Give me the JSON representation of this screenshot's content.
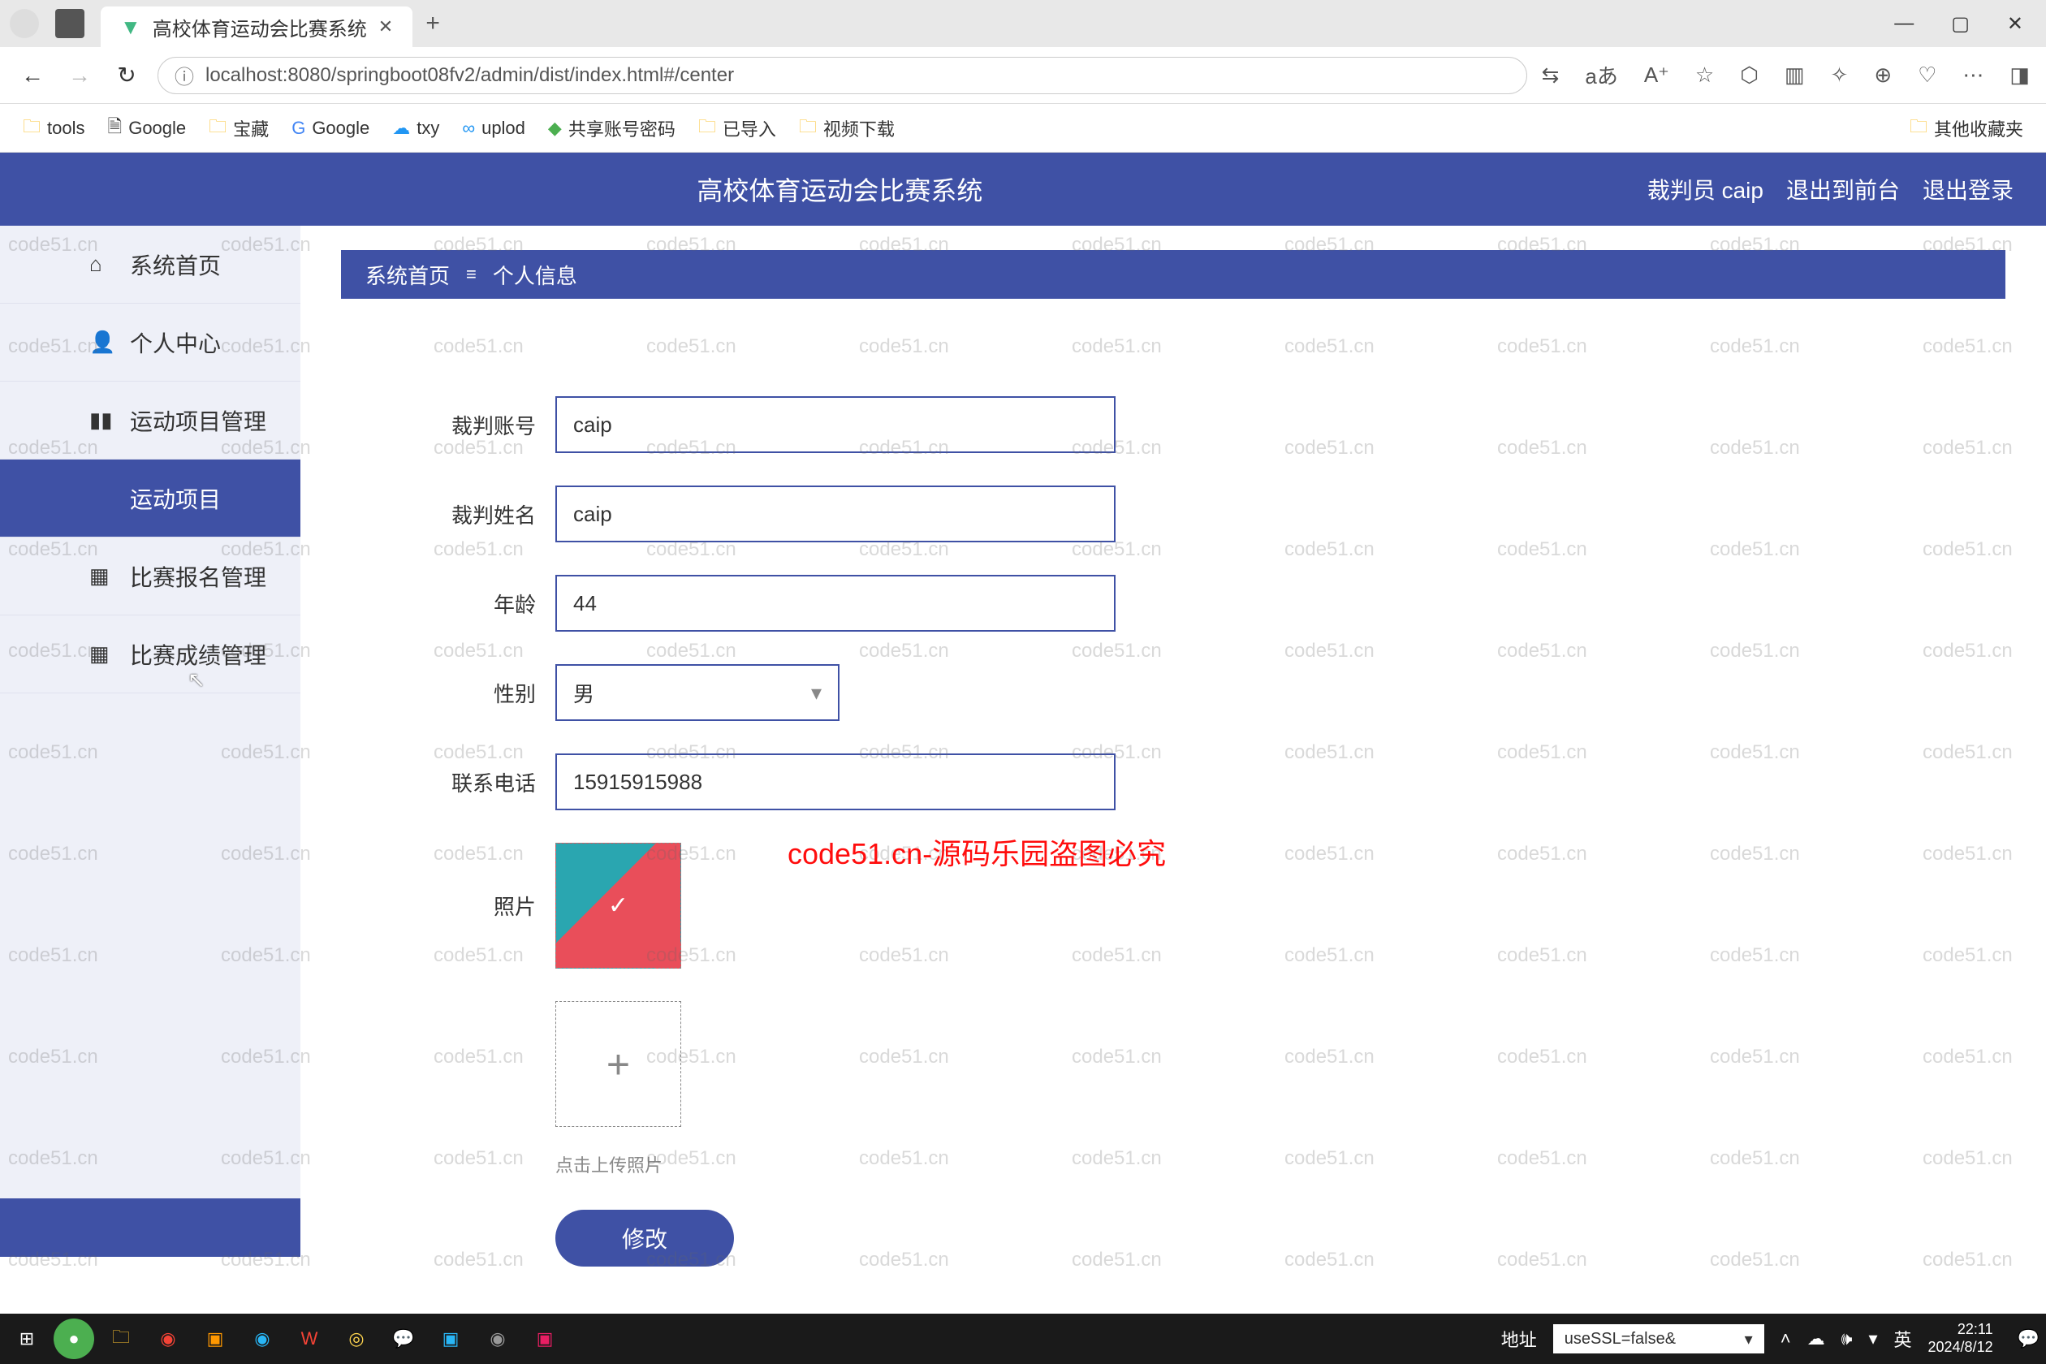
{
  "browser": {
    "tab_title": "高校体育运动会比赛系统",
    "url": "localhost:8080/springboot08fv2/admin/dist/index.html#/center",
    "bookmarks": [
      "tools",
      "Google",
      "宝藏",
      "Google",
      "txy",
      "uplod",
      "共享账号密码",
      "已导入",
      "视频下载"
    ],
    "other_bookmarks": "其他收藏夹"
  },
  "header": {
    "title": "高校体育运动会比赛系统",
    "user": "裁判员 caip",
    "logout_front": "退出到前台",
    "logout": "退出登录"
  },
  "sidebar": {
    "items": [
      {
        "label": "系统首页"
      },
      {
        "label": "个人中心"
      },
      {
        "label": "运动项目管理"
      },
      {
        "label": "运动项目"
      },
      {
        "label": "比赛报名管理"
      },
      {
        "label": "比赛成绩管理"
      }
    ]
  },
  "breadcrumb": {
    "home": "系统首页",
    "page": "个人信息"
  },
  "form": {
    "fields": {
      "account_label": "裁判账号",
      "account_value": "caip",
      "name_label": "裁判姓名",
      "name_value": "caip",
      "age_label": "年龄",
      "age_value": "44",
      "gender_label": "性别",
      "gender_value": "男",
      "phone_label": "联系电话",
      "phone_value": "15915915988",
      "photo_label": "照片"
    },
    "upload_hint": "点击上传照片",
    "submit": "修改"
  },
  "watermark": {
    "text": "code51.cn",
    "red": "code51.cn-源码乐园盗图必究"
  },
  "taskbar": {
    "address_label": "地址",
    "dropdown_value": "useSSL=false&",
    "ime": "英",
    "time": "22:11",
    "date": "2024/8/12"
  }
}
